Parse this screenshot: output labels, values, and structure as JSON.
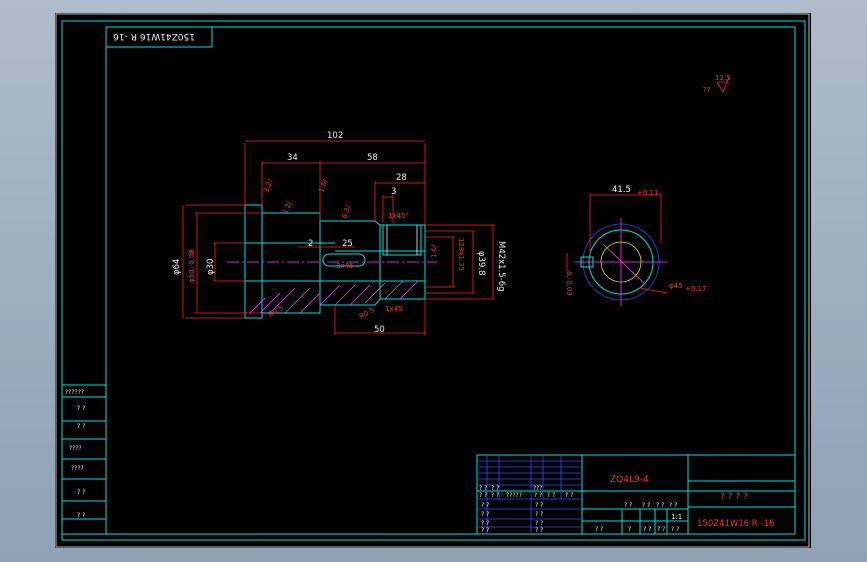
{
  "title_stamp": "150Z41W16 R -16",
  "roughness": {
    "marker": "??",
    "value": "12.5"
  },
  "front_view": {
    "dims_top": [
      "102",
      "34",
      "58",
      "28",
      "3"
    ],
    "dims_mid": [
      "2",
      "25"
    ],
    "dims_bottom": [
      "50"
    ],
    "dims_left": [
      "φ64",
      "φ50.-0.08",
      "φ30"
    ],
    "dims_right": [
      "128x1.35",
      "φ39.8",
      "M42x1.5-6g"
    ],
    "notes": [
      "3.2/",
      "1.6/",
      "3.2/",
      "6.3/",
      "1.6/",
      "3x45",
      "1x45°",
      "1x45",
      "R0.5",
      "R0.5"
    ]
  },
  "side_view": {
    "dim_top": "41.5",
    "dim_top_tol": "+0.11",
    "dim_left": "6.-0.03",
    "dim_right": "φ45",
    "dim_right_tol": "+0.17"
  },
  "title_block": {
    "part_number": "ZQ4L9-4",
    "part_name": "? ? ? ?",
    "drawing_no": "150Z41W16 R -16",
    "scale": "1:1",
    "row_labels_left": [
      "??????",
      "? ?",
      "? ?",
      "????",
      "????",
      "? ?",
      "? ?"
    ],
    "header_cells": [
      "? ?",
      "? ?",
      "?????",
      "? ?",
      "? ?",
      "? ?"
    ],
    "sign_cells": [
      "? ?",
      "? ?",
      "? ?",
      "? ?",
      "? ?",
      "? ?",
      "? ?",
      "? ?",
      "???",
      "? ?",
      "? ?"
    ],
    "scale_cells": [
      "? ?",
      "? ?",
      "? ?",
      "? ?"
    ],
    "sheet_cells": [
      "? ?",
      "?",
      "? ?",
      "? ?",
      "? ?"
    ]
  }
}
